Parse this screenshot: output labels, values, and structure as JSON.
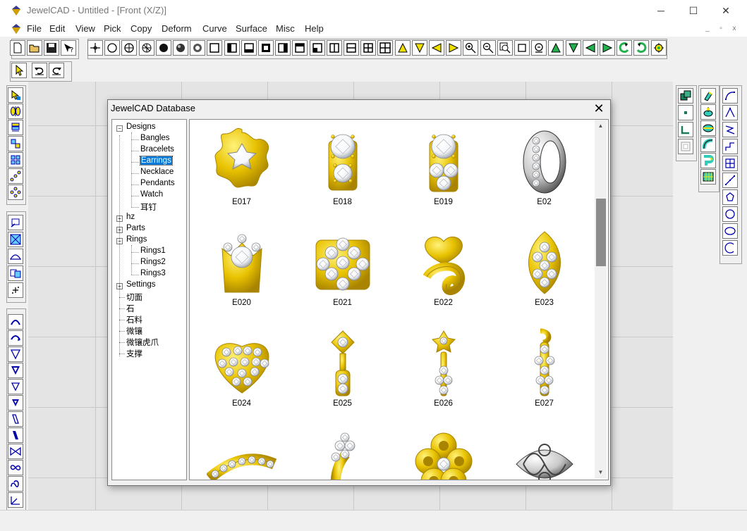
{
  "app": {
    "title": "JewelCAD - Untitled - [Front (X/Z)]",
    "window_controls": [
      "─",
      "☐",
      "✕"
    ],
    "mdi_controls": [
      "_",
      "▫",
      "x"
    ]
  },
  "menu": [
    "File",
    "Edit",
    "View",
    "Pick",
    "Copy",
    "Deform",
    "Curve",
    "Surface",
    "Misc",
    "Help"
  ],
  "toolbar_main": [
    {
      "name": "new-file-icon",
      "glyph": "doc"
    },
    {
      "name": "open-file-icon",
      "glyph": "folder"
    },
    {
      "name": "save-icon",
      "glyph": "disk"
    },
    {
      "name": "help-pointer-icon",
      "glyph": "help"
    },
    {
      "name": "crosshair-icon",
      "glyph": "cross"
    },
    {
      "name": "circle-icon",
      "glyph": "circle"
    },
    {
      "name": "circle-cross-icon",
      "glyph": "circlecross"
    },
    {
      "name": "sphere-grid-icon",
      "glyph": "circlegrid"
    },
    {
      "name": "filled-circle-icon",
      "glyph": "dot"
    },
    {
      "name": "shaded-circle-icon",
      "glyph": "shaded"
    },
    {
      "name": "render-circle-icon",
      "glyph": "render"
    },
    {
      "name": "view-single-icon",
      "glyph": "square"
    },
    {
      "name": "view-left-icon",
      "glyph": "sqleft"
    },
    {
      "name": "view-bottom-icon",
      "glyph": "sqbottom"
    },
    {
      "name": "view-center-icon",
      "glyph": "sqcenter"
    },
    {
      "name": "view-right-icon",
      "glyph": "sqright"
    },
    {
      "name": "view-top-icon",
      "glyph": "sqtop"
    },
    {
      "name": "view-corner-icon",
      "glyph": "sqcorner"
    },
    {
      "name": "split-vertical-icon",
      "glyph": "splitv"
    },
    {
      "name": "split-horizontal-icon",
      "glyph": "splith"
    },
    {
      "name": "split-four-icon",
      "glyph": "split4"
    },
    {
      "name": "split-quad-icon",
      "glyph": "split4b"
    },
    {
      "name": "triangle-up-icon",
      "glyph": "triup"
    },
    {
      "name": "triangle-down-icon",
      "glyph": "tridown"
    },
    {
      "name": "triangle-left-icon",
      "glyph": "trileft"
    },
    {
      "name": "triangle-right-icon",
      "glyph": "triright"
    },
    {
      "name": "zoom-in-icon",
      "glyph": "zoomin"
    },
    {
      "name": "zoom-out-icon",
      "glyph": "zoomout"
    },
    {
      "name": "zoom-window-icon",
      "glyph": "zoomwin"
    },
    {
      "name": "zoom-box-icon",
      "glyph": "box"
    },
    {
      "name": "zoom-fit-icon",
      "glyph": "zoomfit"
    },
    {
      "name": "rotate-up-icon",
      "glyph": "gup"
    },
    {
      "name": "rotate-down-icon",
      "glyph": "gdown"
    },
    {
      "name": "rotate-left-icon",
      "glyph": "gleft"
    },
    {
      "name": "rotate-right-icon",
      "glyph": "gright"
    },
    {
      "name": "spin-ccw-icon",
      "glyph": "spinl"
    },
    {
      "name": "spin-cw-icon",
      "glyph": "spinr"
    },
    {
      "name": "render-settings-icon",
      "glyph": "cog"
    }
  ],
  "toolbar_secondary": [
    {
      "name": "select-arrow-icon",
      "glyph": "arrow"
    },
    {
      "name": "undo-icon",
      "glyph": "undo"
    },
    {
      "name": "redo-icon",
      "glyph": "redo"
    }
  ],
  "left_tools": [
    {
      "name": "pick-all-icon",
      "glyph": "pickall"
    },
    {
      "name": "pick-mirror-icon",
      "glyph": "mirror"
    },
    {
      "name": "pick-stack-icon",
      "glyph": "stack"
    },
    {
      "name": "pick-group-icon",
      "glyph": "group"
    },
    {
      "name": "pick-grid-icon",
      "glyph": "grid"
    },
    {
      "name": "pick-diagonal-icon",
      "glyph": "diag"
    },
    {
      "name": "pick-cluster-icon",
      "glyph": "cluster"
    },
    {
      "name": "edit-point-icon",
      "glyph": "editpt"
    },
    {
      "name": "fit-box-icon",
      "glyph": "fitbox"
    },
    {
      "name": "dome-icon",
      "glyph": "dome"
    },
    {
      "name": "move-copy-icon",
      "glyph": "movecopy"
    },
    {
      "name": "add-point-icon",
      "glyph": "addpt"
    },
    {
      "name": "arc-up-icon",
      "glyph": "arcup"
    },
    {
      "name": "arc-turn-icon",
      "glyph": "arcturn"
    },
    {
      "name": "cone-icon",
      "glyph": "cone"
    },
    {
      "name": "cone-filled-icon",
      "glyph": "conef"
    },
    {
      "name": "cone-small-icon",
      "glyph": "cones"
    },
    {
      "name": "cone-small-filled-icon",
      "glyph": "conesf"
    },
    {
      "name": "parallelogram-icon",
      "glyph": "para"
    },
    {
      "name": "parallelogram-filled-icon",
      "glyph": "paraf"
    },
    {
      "name": "bowtie-icon",
      "glyph": "bowtie"
    },
    {
      "name": "infinity-icon",
      "glyph": "inf"
    },
    {
      "name": "wave-icon",
      "glyph": "wave"
    },
    {
      "name": "axis-icon",
      "glyph": "axis"
    }
  ],
  "right_tools_a": [
    {
      "name": "copy-layers-icon",
      "glyph": "layers"
    },
    {
      "name": "center-point-icon",
      "glyph": "cdot"
    },
    {
      "name": "corner-icon",
      "glyph": "corner"
    },
    {
      "name": "frame-icon",
      "glyph": "frame"
    }
  ],
  "right_tools_b": [
    {
      "name": "extrude-icon",
      "glyph": "extrude"
    },
    {
      "name": "revolve-icon",
      "glyph": "revolve"
    },
    {
      "name": "loft-icon",
      "glyph": "loft"
    },
    {
      "name": "tube-icon",
      "glyph": "tube"
    },
    {
      "name": "sweep-icon",
      "glyph": "sweep"
    },
    {
      "name": "grid-surface-icon",
      "glyph": "gsurf"
    }
  ],
  "right_tools_c": [
    {
      "name": "curve-open-icon",
      "glyph": "c1"
    },
    {
      "name": "curve-angle-icon",
      "glyph": "c2"
    },
    {
      "name": "curve-zigzag-icon",
      "glyph": "c3"
    },
    {
      "name": "curve-step-icon",
      "glyph": "c4"
    },
    {
      "name": "curve-mesh-icon",
      "glyph": "c5"
    },
    {
      "name": "curve-line-icon",
      "glyph": "c6"
    },
    {
      "name": "curve-closed-icon",
      "glyph": "c7"
    },
    {
      "name": "circle-curve-icon",
      "glyph": "c8"
    },
    {
      "name": "ellipse-curve-icon",
      "glyph": "c9"
    },
    {
      "name": "arc-curve-icon",
      "glyph": "c10"
    }
  ],
  "dialog": {
    "title": "JewelCAD Database",
    "close": "✕",
    "tree": [
      {
        "label": "Designs",
        "depth": 0,
        "box": "−",
        "selected": false
      },
      {
        "label": "Bangles",
        "depth": 1,
        "box": "",
        "selected": false
      },
      {
        "label": "Bracelets",
        "depth": 1,
        "box": "",
        "selected": false
      },
      {
        "label": "Earrings",
        "depth": 1,
        "box": "",
        "selected": true
      },
      {
        "label": "Necklace",
        "depth": 1,
        "box": "",
        "selected": false
      },
      {
        "label": "Pendants",
        "depth": 1,
        "box": "",
        "selected": false
      },
      {
        "label": "Watch",
        "depth": 1,
        "box": "",
        "selected": false
      },
      {
        "label": "耳钉",
        "depth": 1,
        "box": "",
        "selected": false
      },
      {
        "label": "hz",
        "depth": 0,
        "box": "+",
        "selected": false
      },
      {
        "label": "Parts",
        "depth": 0,
        "box": "+",
        "selected": false
      },
      {
        "label": "Rings",
        "depth": 0,
        "box": "−",
        "selected": false
      },
      {
        "label": "Rings1",
        "depth": 1,
        "box": "",
        "selected": false
      },
      {
        "label": "Rings2",
        "depth": 1,
        "box": "",
        "selected": false
      },
      {
        "label": "Rings3",
        "depth": 1,
        "box": "",
        "selected": false
      },
      {
        "label": "Settings",
        "depth": 0,
        "box": "+",
        "selected": false
      },
      {
        "label": "切面",
        "depth": 0,
        "box": "",
        "selected": false
      },
      {
        "label": "石",
        "depth": 0,
        "box": "",
        "selected": false
      },
      {
        "label": "石料",
        "depth": 0,
        "box": "",
        "selected": false
      },
      {
        "label": "微镶",
        "depth": 0,
        "box": "",
        "selected": false
      },
      {
        "label": "微镶虎爪",
        "depth": 0,
        "box": "",
        "selected": false
      },
      {
        "label": "支撑",
        "depth": 0,
        "box": "",
        "selected": false
      }
    ],
    "items": [
      {
        "label": "E017",
        "shape": "flower-setting"
      },
      {
        "label": "E018",
        "shape": "double-stone"
      },
      {
        "label": "E019",
        "shape": "triple-stone"
      },
      {
        "label": "E02",
        "shape": "silver-hoop"
      },
      {
        "label": "E020",
        "shape": "crown-setting"
      },
      {
        "label": "E021",
        "shape": "cluster-flower"
      },
      {
        "label": "E022",
        "shape": "heart-swirl"
      },
      {
        "label": "E023",
        "shape": "marquise-pave"
      },
      {
        "label": "E024",
        "shape": "heart-pave"
      },
      {
        "label": "E025",
        "shape": "square-drop"
      },
      {
        "label": "E026",
        "shape": "floral-drop"
      },
      {
        "label": "E027",
        "shape": "swirl-drop"
      },
      {
        "label": "",
        "shape": "curved-bar"
      },
      {
        "label": "",
        "shape": "flower-stem"
      },
      {
        "label": "",
        "shape": "gold-flower"
      },
      {
        "label": "",
        "shape": "silver-filigree"
      }
    ],
    "scroll": {
      "position": 0.25
    },
    "arrows": {
      "up": "▲",
      "down": "▼"
    }
  },
  "colors": {
    "gold": "#e8c200",
    "gold_dark": "#a88400",
    "gold_light": "#fff27a",
    "silver": "#c8c8c8",
    "diamond": "#f4f6fa",
    "selection": "#0078d7"
  }
}
